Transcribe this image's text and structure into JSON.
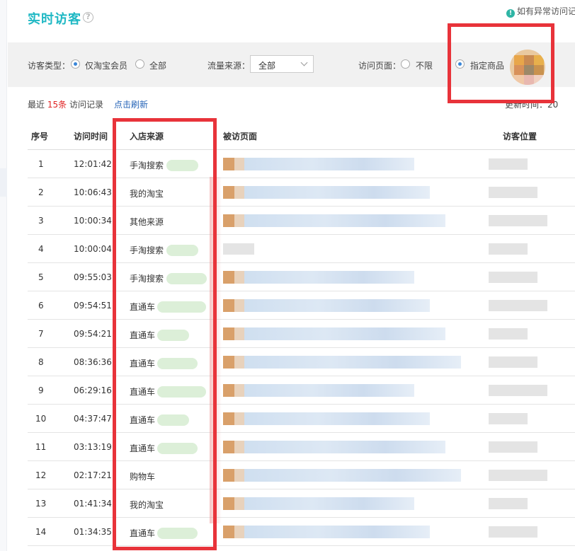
{
  "header": {
    "title": "实时访客",
    "notice": "如有异常访问记"
  },
  "filters": {
    "visitor_type_label": "访客类型：",
    "visitor_type_options": [
      "仅淘宝会员",
      "全部"
    ],
    "visitor_type_selected": "仅淘宝会员",
    "traffic_source_label": "流量来源：",
    "traffic_source_value": "全部",
    "visit_page_label": "访问页面：",
    "visit_page_options": [
      "不限",
      "指定商品"
    ],
    "visit_page_selected": "指定商品"
  },
  "summary": {
    "recent_prefix": "最近",
    "recent_count": "15条",
    "recent_suffix": "访问记录",
    "refresh_link": "点击刷新",
    "update_time": "更新时间：20"
  },
  "table": {
    "columns": [
      "序号",
      "访问时间",
      "入店来源",
      "被访页面",
      "访客位置"
    ],
    "rows": [
      {
        "index": "1",
        "time": "12:01:42",
        "source": "手淘搜索"
      },
      {
        "index": "2",
        "time": "10:06:43",
        "source": "我的淘宝"
      },
      {
        "index": "3",
        "time": "10:00:34",
        "source": "其他来源"
      },
      {
        "index": "4",
        "time": "10:00:04",
        "source": "手淘搜索"
      },
      {
        "index": "5",
        "time": "09:55:03",
        "source": "手淘搜索"
      },
      {
        "index": "6",
        "time": "09:54:51",
        "source": "直通车"
      },
      {
        "index": "7",
        "time": "09:54:21",
        "source": "直通车"
      },
      {
        "index": "8",
        "time": "08:36:36",
        "source": "直通车"
      },
      {
        "index": "9",
        "time": "06:29:16",
        "source": "直通车"
      },
      {
        "index": "10",
        "time": "04:37:47",
        "source": "直通车"
      },
      {
        "index": "11",
        "time": "03:13:19",
        "source": "直通车"
      },
      {
        "index": "12",
        "time": "02:17:21",
        "source": "购物车"
      },
      {
        "index": "13",
        "time": "01:41:34",
        "source": "我的淘宝"
      },
      {
        "index": "14",
        "time": "01:34:35",
        "source": "直通车"
      }
    ]
  },
  "colors": {
    "title": "#1fb8c4",
    "highlight_box": "#e8333a",
    "count_red": "#e02424",
    "link_blue": "#2866b8"
  }
}
